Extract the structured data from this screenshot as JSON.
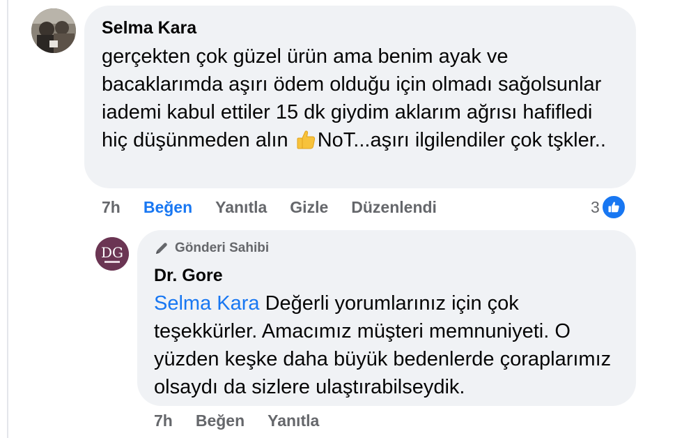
{
  "comment": {
    "author": "Selma Kara",
    "text": "gerçekten çok güzel ürün ama benim ayak ve bacaklarımda aşırı ödem olduğu için olmadı sağolsunlar iademi kabul ettiler 15 dk giydim aklarım ağrısı hafifledi hiç düşünmeden alın",
    "text_after_emoji": "NoT...aşırı ilgilendiler çok tşkler..",
    "emoji": "thumbs-up-icon",
    "actions": {
      "time": "7h",
      "like": "Beğen",
      "reply": "Yanıtla",
      "hide": "Gizle",
      "edited": "Düzenlendi"
    },
    "reaction_count": "3",
    "reaction_icon": "like-icon"
  },
  "reply": {
    "badge": "Gönderi Sahibi",
    "badge_icon": "pen-icon",
    "author": "Dr. Gore",
    "mention": "Selma Kara",
    "text": "Değerli yorumlarınız için çok teşekkürler. Amacımız müşteri memnuniyeti. O yüzden keşke daha büyük bedenlerde çoraplarımız olsaydı da sizlere ulaştırabilseydik.",
    "avatar_text": "DG",
    "actions": {
      "time": "7h",
      "like": "Beğen",
      "reply": "Yanıtla"
    }
  },
  "colors": {
    "bubble": "#f0f2f5",
    "accent": "#1877f2",
    "secondary_text": "#65676b",
    "avatar_reply": "#6b3553"
  }
}
